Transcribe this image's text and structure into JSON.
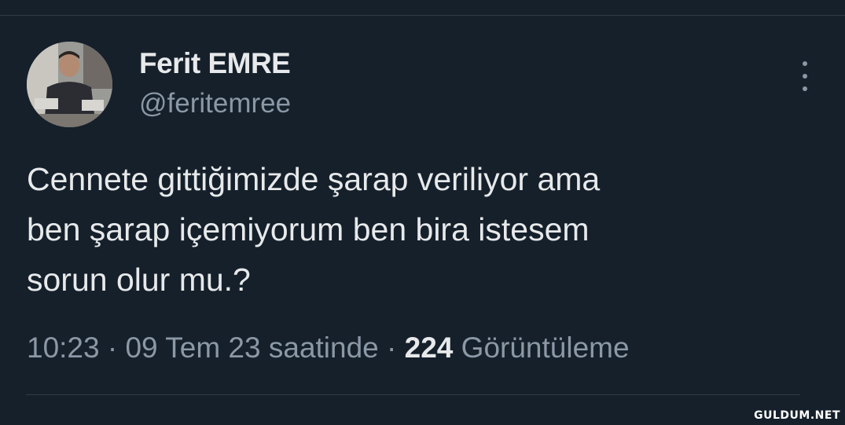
{
  "tweet": {
    "display_name": "Ferit EMRE",
    "handle": "@feritemree",
    "text_lines": [
      "Cennete gittiğimizde şarap veriliyor ama",
      "ben şarap içemiyorum ben bira istesem",
      "sorun olur mu.?"
    ],
    "time": "10:23",
    "separator": "·",
    "date": "09 Tem 23 saatinde",
    "views_count": "224",
    "views_label": "Görüntüleme"
  },
  "icons": {
    "more": "more-vertical-icon"
  },
  "watermark": "GULDUM.NET",
  "colors": {
    "background": "#15202b",
    "primary_text": "#e7e9ea",
    "secondary_text": "#8b98a5"
  }
}
